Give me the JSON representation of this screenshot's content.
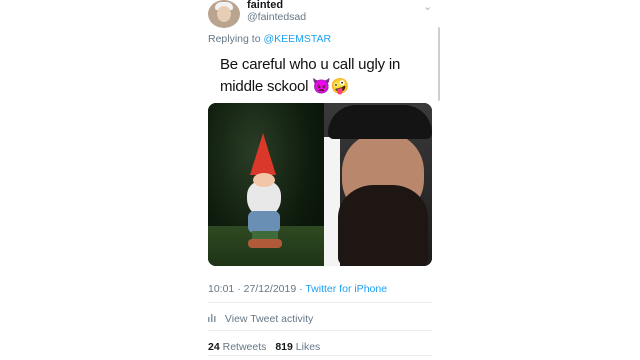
{
  "profile": {
    "name": "fainted",
    "handle": "@faintedsad"
  },
  "reply": {
    "prefix": "Replying to",
    "mention": "@KEEMSTAR"
  },
  "tweet": {
    "text": "Be careful who u call ugly in middle sckool 👿🤪"
  },
  "meta": {
    "time": "10:01",
    "date": "27/12/2019",
    "source": "Twitter for iPhone",
    "separator": "·"
  },
  "activity": {
    "label": "View Tweet activity",
    "icon": "bar-chart-icon"
  },
  "stats": {
    "retweets_count": "24",
    "retweets_label": "Retweets",
    "likes_count": "819",
    "likes_label": "Likes"
  },
  "icons": {
    "chevron": "chevron-down-icon"
  },
  "colors": {
    "link": "#1da1f2",
    "secondary": "#657786",
    "divider": "#e6ecf0"
  }
}
